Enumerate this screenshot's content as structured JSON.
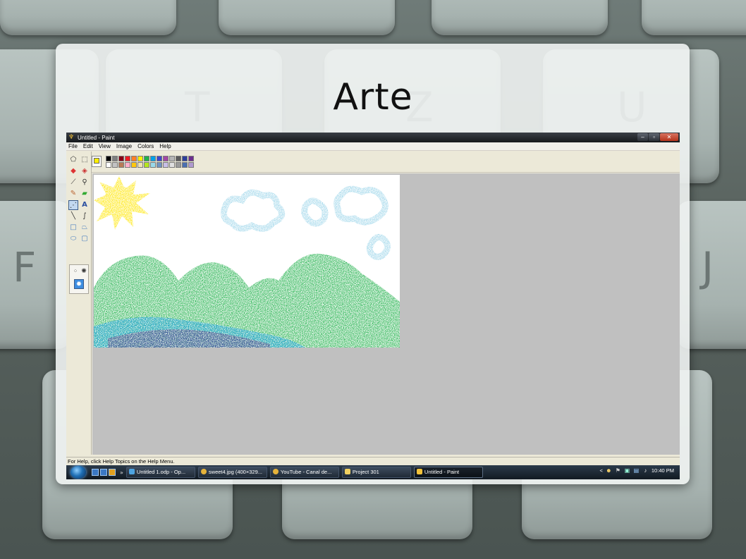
{
  "slide": {
    "title": "Arte"
  },
  "keyboard": {
    "letters": [
      "T",
      "Z",
      "U",
      "F",
      "J"
    ]
  },
  "window": {
    "title": "Untitled - Paint",
    "controls": {
      "minimize": "–",
      "maximize": "▫",
      "close": "✕"
    }
  },
  "menu": {
    "items": [
      "File",
      "Edit",
      "View",
      "Image",
      "Colors",
      "Help"
    ]
  },
  "tools": {
    "text_tool_glyph": "A"
  },
  "colors": {
    "foreground": "#ffee00",
    "background": "#ffffff",
    "palette_row1": [
      "#000000",
      "#7f7f7f",
      "#880015",
      "#ed1c24",
      "#ff7f27",
      "#fff200",
      "#22b14c",
      "#00a2e8",
      "#3f48cc",
      "#a349a4",
      "#b5b5b5",
      "#5b5b5b",
      "#2d3f9a",
      "#6d2f8f"
    ],
    "palette_row2": [
      "#ffffff",
      "#c3c3c3",
      "#b97a57",
      "#ffaec9",
      "#ffc90e",
      "#efe4b0",
      "#b5e61d",
      "#99d9ea",
      "#7092be",
      "#c8bfe7",
      "#e0e0e0",
      "#9a9a9a",
      "#4a6fb0",
      "#b09ad0"
    ]
  },
  "status": {
    "text": "For Help, click Help Topics on the Help Menu."
  },
  "taskbar": {
    "chevron": "»",
    "buttons": [
      {
        "label": "Untitled 1.odp - Op...",
        "color": "#4da3e0"
      },
      {
        "label": "sweet4.jpg (400×329...",
        "color": "#e6b33a"
      },
      {
        "label": "YouTube - Canal de...",
        "color": "#e6b33a"
      },
      {
        "label": "Project 301",
        "color": "#f0d060"
      },
      {
        "label": "Untitled - Paint",
        "color": "#f2c23a"
      }
    ],
    "tray_chevron": "<",
    "clock": "10:40 PM"
  }
}
